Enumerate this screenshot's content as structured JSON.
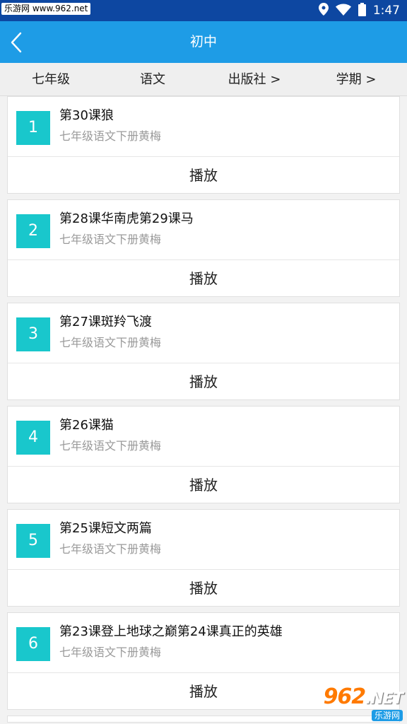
{
  "status_bar": {
    "watermark": "乐游网 www.962.net",
    "time": "1:47"
  },
  "app_bar": {
    "title": "初中"
  },
  "filters": [
    {
      "label": "七年级"
    },
    {
      "label": "语文"
    },
    {
      "label": "出版社 >"
    },
    {
      "label": "学期 >"
    }
  ],
  "lessons": [
    {
      "num": "1",
      "title": "第30课狼",
      "subtitle": "七年级语文下册黄梅",
      "action": "播放"
    },
    {
      "num": "2",
      "title": "第28课华南虎第29课马",
      "subtitle": "七年级语文下册黄梅",
      "action": "播放"
    },
    {
      "num": "3",
      "title": "第27课斑羚飞渡",
      "subtitle": "七年级语文下册黄梅",
      "action": "播放"
    },
    {
      "num": "4",
      "title": "第26课猫",
      "subtitle": "七年级语文下册黄梅",
      "action": "播放"
    },
    {
      "num": "5",
      "title": "第25课短文两篇",
      "subtitle": "七年级语文下册黄梅",
      "action": "播放"
    },
    {
      "num": "6",
      "title": "第23课登上地球之巅第24课真正的英雄",
      "subtitle": "七年级语文下册黄梅",
      "action": "播放"
    }
  ],
  "watermark": {
    "logo": "962",
    "logo_suffix": ".NET",
    "logo_sub": "乐游网"
  },
  "colors": {
    "status_bar": "#0d47a1",
    "app_bar": "#1e9ce6",
    "badge": "#19c7cc"
  }
}
